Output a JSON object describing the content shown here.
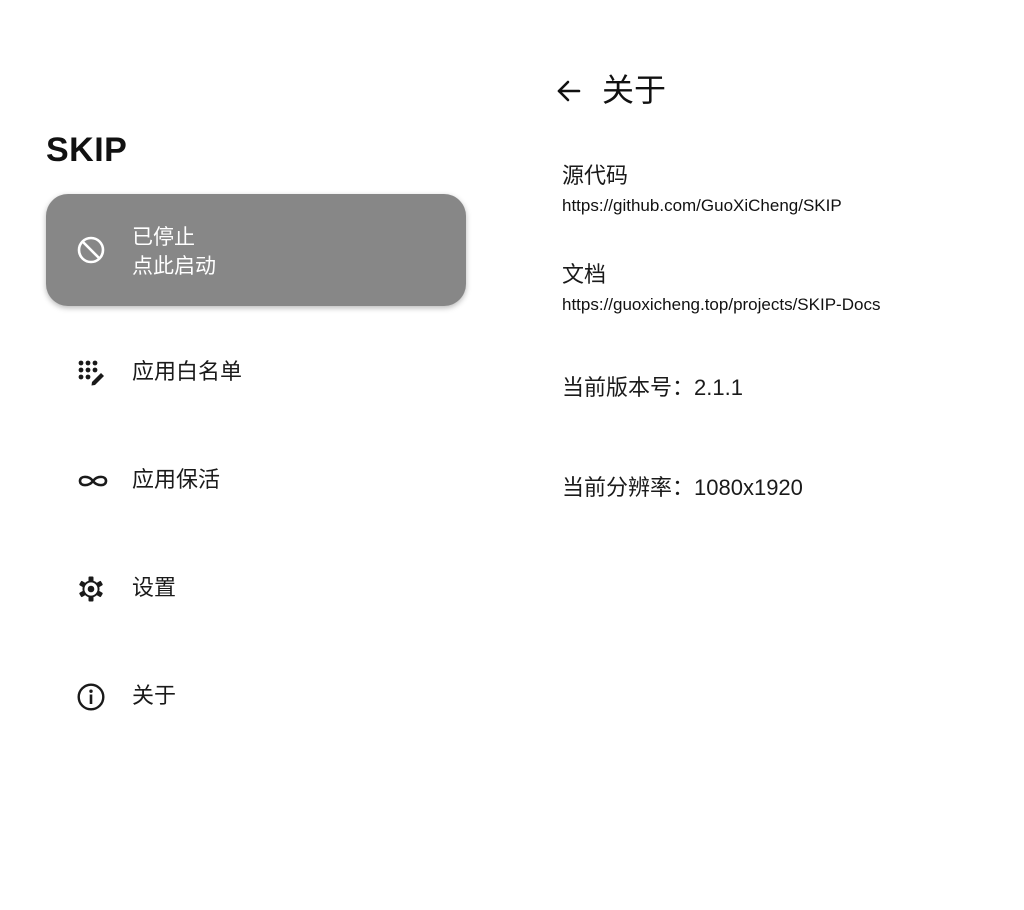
{
  "sidebar": {
    "app_title": "SKIP",
    "status_card": {
      "status": "已停止",
      "action": "点此启动",
      "icon": "block-icon"
    },
    "items": [
      {
        "label": "应用白名单",
        "icon": "apps-edit-icon"
      },
      {
        "label": "应用保活",
        "icon": "infinity-icon"
      },
      {
        "label": "设置",
        "icon": "gear-icon"
      },
      {
        "label": "关于",
        "icon": "info-icon"
      }
    ]
  },
  "about": {
    "back_icon": "arrow-back-icon",
    "title": "关于",
    "source": {
      "label": "源代码",
      "url": "https://github.com/GuoXiCheng/SKIP"
    },
    "docs": {
      "label": "文档",
      "url": "https://guoxicheng.top/projects/SKIP-Docs"
    },
    "version": {
      "label": "当前版本号：",
      "value": "2.1.1"
    },
    "resolution": {
      "label": "当前分辨率：",
      "value": "1080x1920"
    }
  },
  "colors": {
    "card_background": "#878787",
    "card_text": "#ffffff",
    "text": "#1a1a1a",
    "background": "#ffffff"
  }
}
